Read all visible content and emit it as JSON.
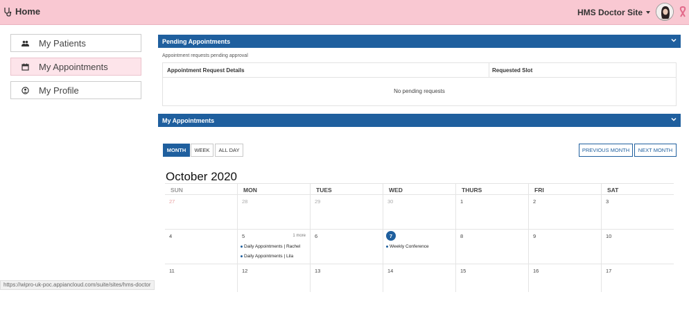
{
  "header": {
    "home_label": "Home",
    "site_label": "HMS Doctor Site"
  },
  "sidebar": {
    "items": [
      {
        "label": "My Patients",
        "icon": "users-icon"
      },
      {
        "label": "My Appointments",
        "icon": "calendar-icon"
      },
      {
        "label": "My Profile",
        "icon": "user-icon"
      }
    ]
  },
  "pending": {
    "title": "Pending Appointments",
    "subtitle": "Appointment requests pending approval",
    "columns": [
      "Appointment Request Details",
      "Requested Slot"
    ],
    "empty_text": "No pending requests"
  },
  "appointments": {
    "title": "My Appointments",
    "view_buttons": [
      "MONTH",
      "WEEK",
      "ALL DAY"
    ],
    "prev_label": "PREVIOUS MONTH",
    "next_label": "NEXT MONTH",
    "month_title": "October 2020",
    "weekdays": [
      "SUN",
      "MON",
      "TUES",
      "WED",
      "THURS",
      "FRI",
      "SAT"
    ],
    "weeks": [
      [
        "27",
        "28",
        "29",
        "30",
        "1",
        "2",
        "3"
      ],
      [
        "4",
        "5",
        "6",
        "7",
        "8",
        "9",
        "10"
      ],
      [
        "11",
        "12",
        "13",
        "14",
        "15",
        "16",
        "17"
      ]
    ],
    "more_label": "1 more",
    "events": {
      "mon5": [
        "Daily Appointments | Rachel",
        "Daily Appointments | Lila"
      ],
      "wed7": [
        "Weekly Conference"
      ]
    }
  },
  "status_url": "https://wipro-uk-poc.appiancloud.com/suite/sites/hms-doctor",
  "colors": {
    "header_bg": "#f9c8d2",
    "panel_blue": "#1f5f9e",
    "active_nav": "#fde4ea"
  }
}
